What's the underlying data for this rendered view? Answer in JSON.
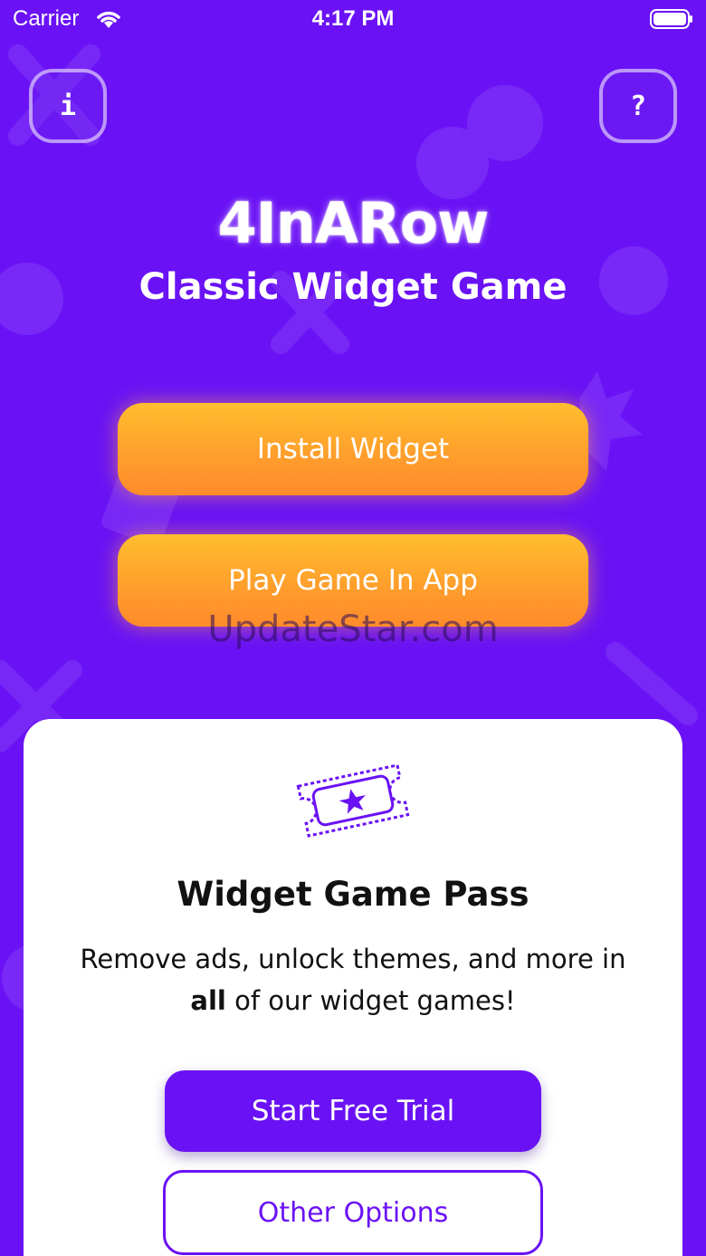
{
  "status_bar": {
    "carrier": "Carrier",
    "time": "4:17 PM"
  },
  "header": {
    "info_label": "i",
    "help_label": "?"
  },
  "title": {
    "app_name": "4InARow",
    "subtitle": "Classic Widget Game"
  },
  "actions": {
    "install_label": "Install Widget",
    "play_label": "Play Game In App"
  },
  "watermark": "UpdateStar.com",
  "pass_card": {
    "title": "Widget Game Pass",
    "description_line1": "Remove ads, unlock themes, and more in",
    "description_bold": "all",
    "description_rest": " of our widget games!",
    "trial_label": "Start Free Trial",
    "options_label": "Other Options",
    "icon": "ticket-star-icon"
  },
  "colors": {
    "background": "#6A12F5",
    "accent_orange": "#FF9F2C",
    "card": "#FFFFFF",
    "primary_purple": "#6A12F5"
  }
}
